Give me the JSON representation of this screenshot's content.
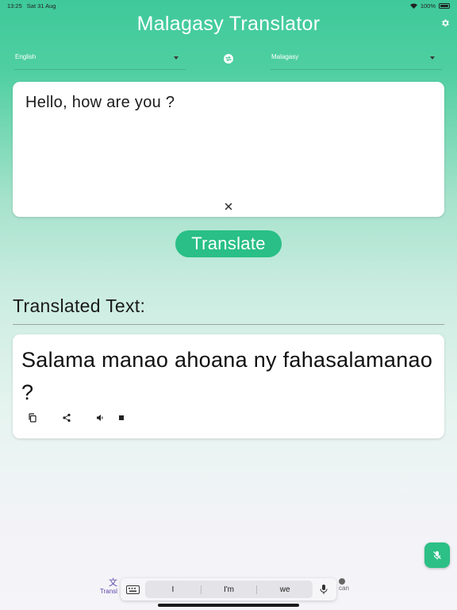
{
  "status_bar": {
    "time": "13:25",
    "date": "Sat 31 Aug",
    "battery": "100%"
  },
  "app": {
    "title": "Malagasy Translator"
  },
  "languages": {
    "source": "English",
    "target": "Malagasy"
  },
  "input": {
    "text": "Hello, how are you ?"
  },
  "actions": {
    "translate_label": "Translate"
  },
  "output": {
    "heading": "Translated Text:",
    "text": "Salama manao ahoana ny fahasalamanao ?"
  },
  "nav": {
    "translate_label": "Transl",
    "scan_label": "can"
  },
  "keyboard": {
    "predictions": [
      "I",
      "I'm",
      "we"
    ]
  },
  "colors": {
    "accent": "#29bf86",
    "nav_active": "#5e46a7"
  }
}
